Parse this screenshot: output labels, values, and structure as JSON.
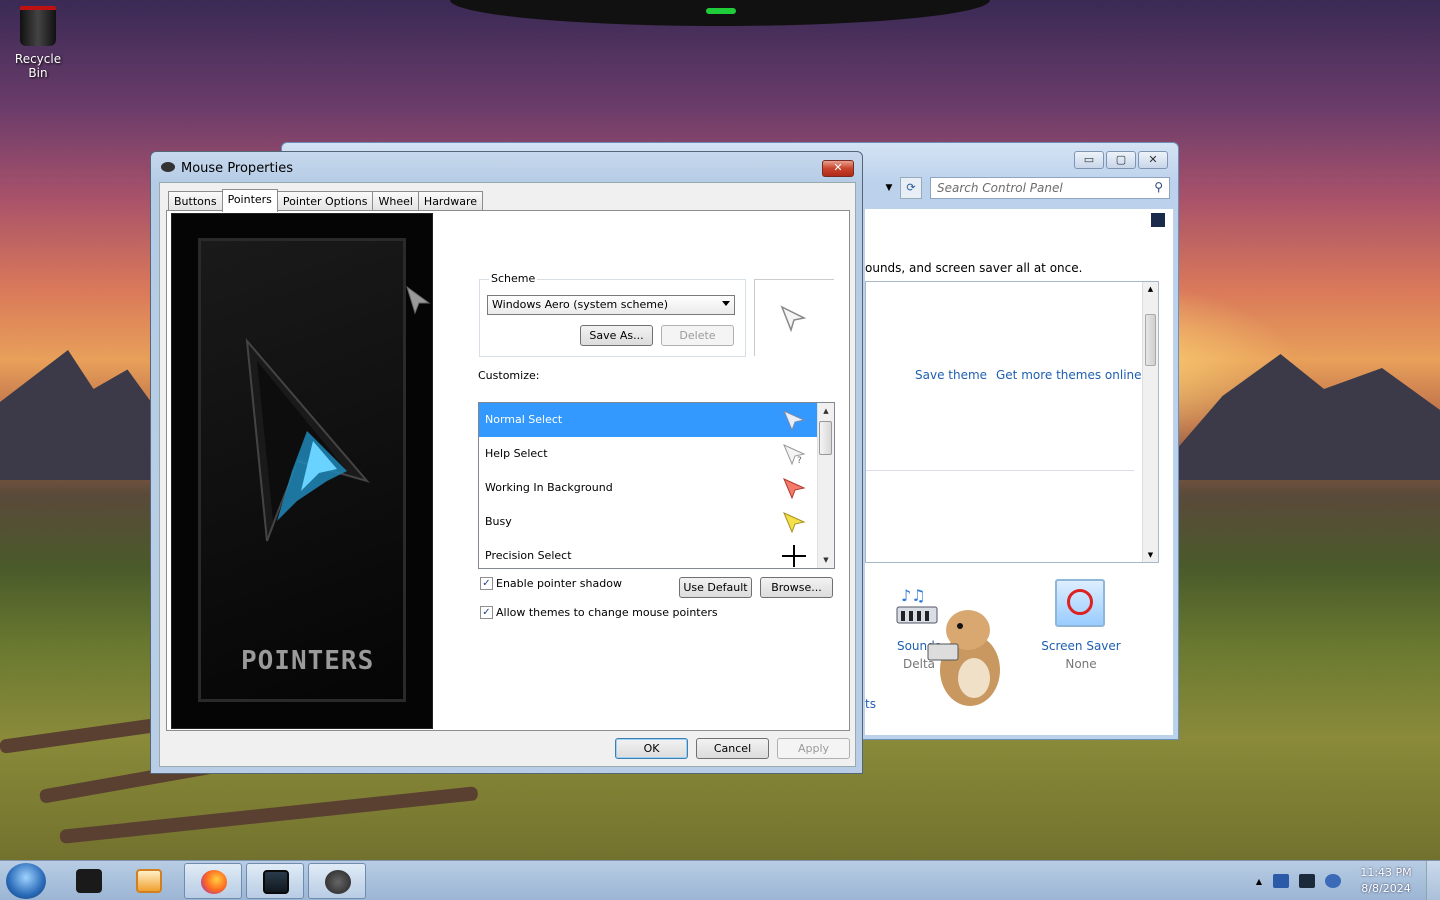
{
  "desktop": {
    "recycle_bin_label": "Recycle Bin"
  },
  "control_panel": {
    "search_placeholder": "Search Control Panel",
    "description_fragment": "ounds, and screen saver all at once.",
    "save_theme": "Save theme",
    "get_more_themes": "Get more themes online",
    "sounds_title": "Sounds",
    "sounds_value": "Delta",
    "screen_saver_title": "Screen Saver",
    "screen_saver_value": "None",
    "fragment_ts": "ts",
    "window_controls": [
      "minimize-icon",
      "maximize-icon",
      "close-icon"
    ]
  },
  "dialog": {
    "title": "Mouse Properties",
    "close_glyph": "✕",
    "tabs": [
      "Buttons",
      "Pointers",
      "Pointer Options",
      "Wheel",
      "Hardware"
    ],
    "active_tab": "Pointers",
    "art_text": "POINTERS",
    "scheme_label": "Scheme",
    "scheme_value": "Windows Aero (system scheme)",
    "save_as": "Save As...",
    "delete": "Delete",
    "customize_label": "Customize:",
    "cursors": [
      {
        "label": "Normal Select",
        "icon": "arrow-cursor-icon",
        "selected": true
      },
      {
        "label": "Help Select",
        "icon": "help-cursor-icon",
        "selected": false
      },
      {
        "label": "Working In Background",
        "icon": "working-cursor-icon",
        "selected": false
      },
      {
        "label": "Busy",
        "icon": "busy-cursor-icon",
        "selected": false
      },
      {
        "label": "Precision Select",
        "icon": "crosshair-cursor-icon",
        "selected": false
      }
    ],
    "enable_shadow": "Enable pointer shadow",
    "enable_shadow_checked": true,
    "allow_themes": "Allow themes to change mouse pointers",
    "allow_themes_checked": true,
    "use_default": "Use Default",
    "browse": "Browse...",
    "ok": "OK",
    "cancel": "Cancel",
    "apply": "Apply"
  },
  "taskbar": {
    "items": [
      "start-orb",
      "terminal-icon",
      "media-player-icon",
      "firefox-icon",
      "display-settings-icon",
      "mouse-icon"
    ],
    "time": "11:43 PM",
    "date": "8/8/2024"
  },
  "colors": {
    "selection": "#3399ff",
    "link": "#1f5fb0"
  }
}
